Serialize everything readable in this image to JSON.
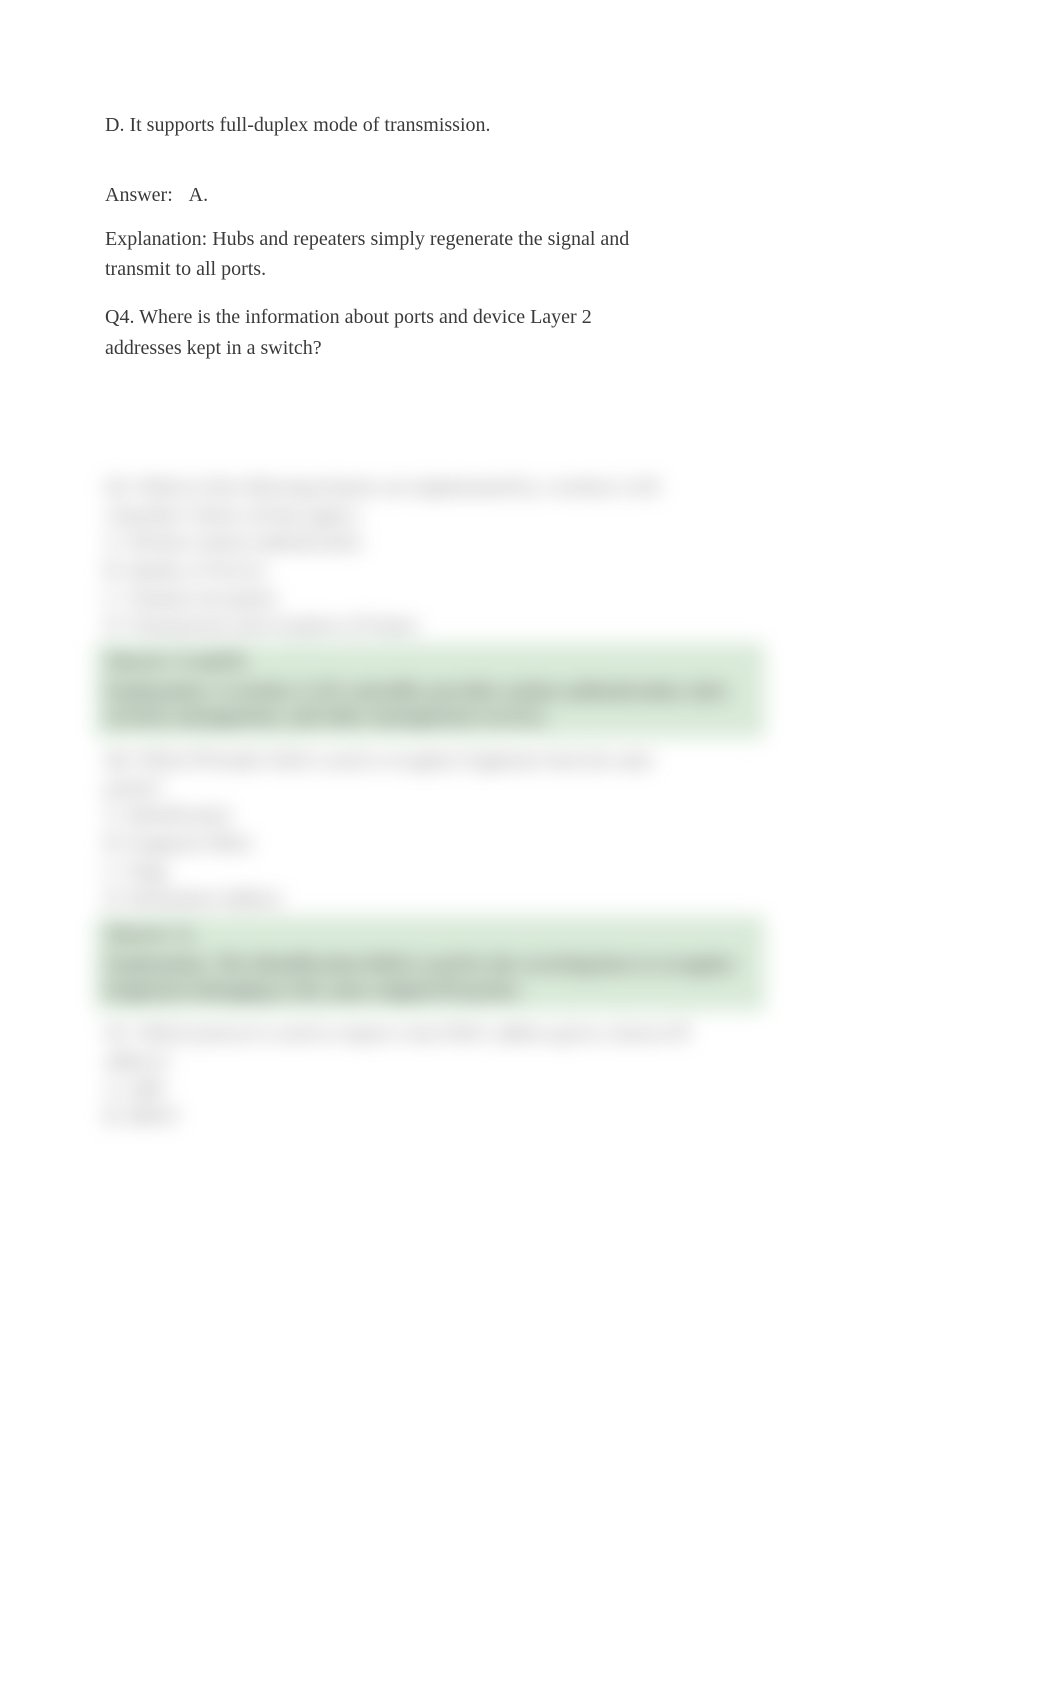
{
  "visible": {
    "optionD": "D. It supports full-duplex mode of transmission.",
    "answerLabel": "Answer:",
    "answerValue": "A.",
    "explanation": "Explanation: Hubs and repeaters simply regenerate the signal and transmit to all ports.",
    "q4": "Q4. Where is the information about ports and device Layer 2 addresses kept in a switch?"
  },
  "blurred": {
    "q5": {
      "stem1": "Q5. Which of the following features are implemented by a wireless LAN",
      "stem2": "controller? (Select all that apply.)",
      "a": "A. Wireless station authentication",
      "b": "B. Quality of Service",
      "c": "C. Channel encryption",
      "d": "D. Transmission and reception of Frames",
      "answer": "Answer:    A and B.",
      "expl": "Explanation: A wireless LAN controller provides station authentication, QoS, security management, and other management services."
    },
    "q6": {
      "stem1": "Q6. Which IP header field is used to recognize fragments from the same",
      "stem2": "packet?",
      "a": "A. Identification",
      "b": "B. Fragment Offset",
      "c": "C. Flags",
      "d": "D. Destination Address",
      "answer": "Answer:    A.",
      "expl": "Explanation: The Identification field is used by the receiving host to recognize fragments belonging to the same original IP packet."
    },
    "q7": {
      "stem1": "Q7. Which protocol is used to request a host MAC address given a known IP",
      "stem2": "address?",
      "a": "A. ARP",
      "b": "B. DHCP"
    }
  }
}
